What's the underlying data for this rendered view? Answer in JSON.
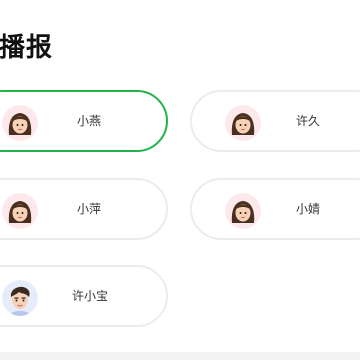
{
  "header": {
    "title": "音播报"
  },
  "voices": [
    {
      "name": "小燕",
      "avatar_icon": "girl-avatar-icon",
      "selected": true
    },
    {
      "name": "许久",
      "avatar_icon": "girl-avatar-icon",
      "selected": false
    },
    {
      "name": "小萍",
      "avatar_icon": "girl-avatar-icon",
      "selected": false
    },
    {
      "name": "小婧",
      "avatar_icon": "girl-avatar-icon",
      "selected": false
    },
    {
      "name": "许小宝",
      "avatar_icon": "boy-avatar-icon",
      "selected": false
    }
  ],
  "colors": {
    "selected_border": "#24b24b",
    "card_border": "#ececec",
    "avatar_bg_girl": "#fde8ec",
    "avatar_bg_boy": "#e6ecfa"
  }
}
